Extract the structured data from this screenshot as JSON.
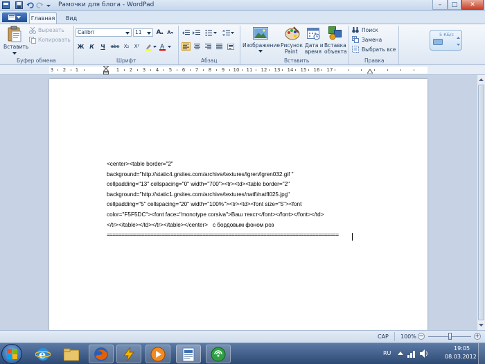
{
  "window": {
    "title": "Рамочки для блога - WordPad",
    "minimize_label": "–",
    "maximize_label": "□",
    "close_label": "✕"
  },
  "tabs": [
    {
      "label": "Главная"
    },
    {
      "label": "Вид"
    }
  ],
  "ribbon": {
    "clipboard": {
      "paste_label": "Вставить",
      "cut_label": "Вырезать",
      "copy_label": "Копировать",
      "group_label": "Буфер обмена"
    },
    "font": {
      "family": "Calibri",
      "size": "11",
      "bold": "Ж",
      "italic": "К",
      "underline": "Ч",
      "strike": "abc",
      "subscript": "X₂",
      "superscript": "X²",
      "grow": "A",
      "shrink": "A",
      "group_label": "Шрифт"
    },
    "paragraph": {
      "group_label": "Абзац"
    },
    "insert": {
      "image_label": "Изображение",
      "paint_label_1": "Рисунок",
      "paint_label_2": "Paint",
      "datetime_label_1": "Дата и",
      "datetime_label_2": "время",
      "object_label_1": "Вставка",
      "object_label_2": "объекта",
      "group_label": "Вставить"
    },
    "editing": {
      "find_label": "Поиск",
      "replace_label": "Замена",
      "select_all_label": "Выбрать все",
      "group_label": "Правка"
    },
    "network_widget": {
      "speed": "5 КБ/с"
    }
  },
  "ruler": {
    "labels": [
      "3",
      "2",
      "1",
      "1",
      "2",
      "3",
      "4",
      "5",
      "6",
      "7",
      "8",
      "9",
      "10",
      "11",
      "12",
      "13",
      "14",
      "15",
      "16",
      "17"
    ]
  },
  "document": {
    "text": "<center><table border=\"2\"\nbackground=\"http://static4.grsites.com/archive/textures/lgren/lgren032.gif \"\ncellpadding=\"13\" cellspacing=\"0\" width=\"700\"><tr><td><table border=\"2\"\nbackground=\"http://static1.grsites.com/archive/textures/natfl/natfl025.jpg\"\ncellpadding=\"5\" cellspacing=\"20\" width=\"100%\"><tr><td><font size=\"5\"><font\ncolor=\"F5F5DC\"><font face=\"monotype corsiva\">Ваш текст</font></font></font></td>\n</tr></table></td></tr></table></center>   с бордовым фоном роз",
    "separator": "================================================================================"
  },
  "status": {
    "caps": "CAP",
    "zoom": "100%"
  },
  "taskbar": {
    "lang": "RU",
    "time": "19:05",
    "date": "08.03.2012"
  }
}
